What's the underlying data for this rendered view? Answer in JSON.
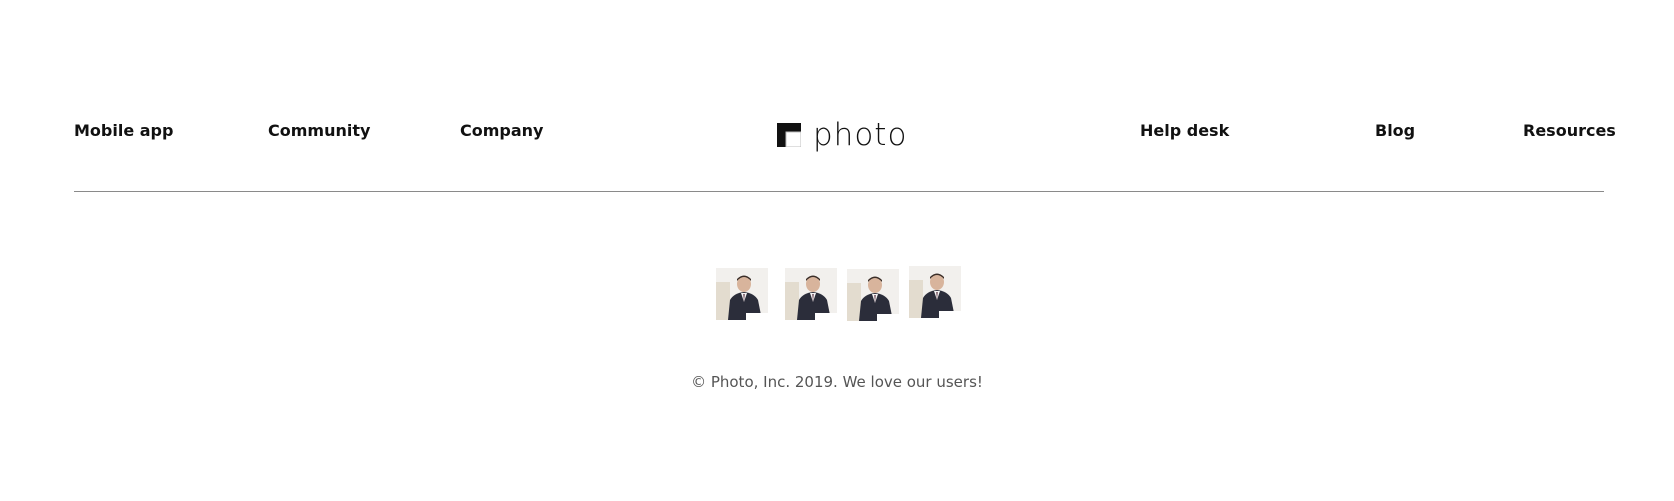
{
  "footer": {
    "nav_left": [
      {
        "label": "Mobile app"
      },
      {
        "label": "Community"
      },
      {
        "label": "Company"
      }
    ],
    "logo": {
      "text": "photo",
      "icon": "photo-logo-mark-icon"
    },
    "nav_right": [
      {
        "label": "Help desk"
      },
      {
        "label": "Blog"
      },
      {
        "label": "Resources"
      }
    ],
    "avatars": [
      {
        "icon": "user-avatar"
      },
      {
        "icon": "user-avatar"
      },
      {
        "icon": "user-avatar"
      },
      {
        "icon": "user-avatar"
      }
    ],
    "copyright": "© Photo, Inc. 2019. We love our users!"
  },
  "colors": {
    "text": "#111111",
    "divider": "#8a8a8a",
    "muted_text": "#555555",
    "background": "#ffffff"
  }
}
